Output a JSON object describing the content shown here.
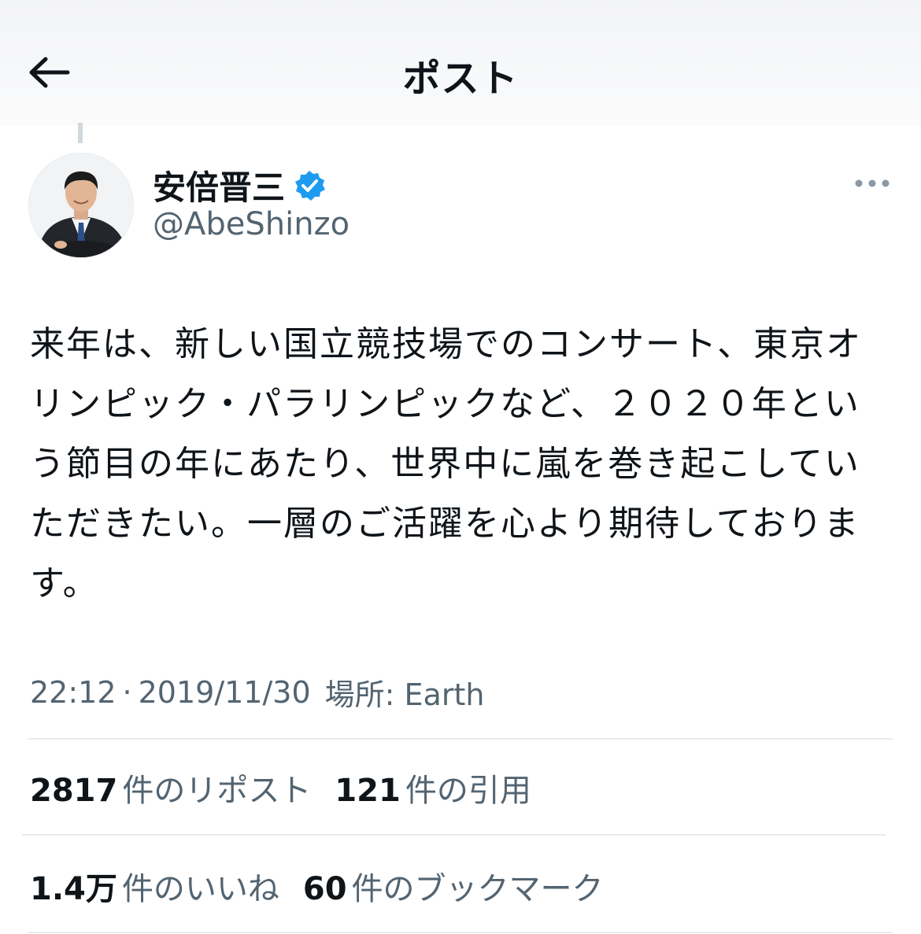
{
  "header": {
    "title": "ポスト",
    "back_icon": "arrow-left-icon"
  },
  "author": {
    "display_name": "安倍晋三",
    "handle": "@AbeShinzo",
    "verified_color": "#1d9bf0"
  },
  "tweet": {
    "text": "来年は、新しい国立競技場でのコンサート、東京オリンピック・パラリンピックなど、２０２０年という節目の年にあたり、世界中に嵐を巻き起こしていただきたい。一層のご活躍を心より期待しております。"
  },
  "meta": {
    "time": "22:12",
    "separator": "·",
    "date": "2019/11/30",
    "location": "場所: Earth"
  },
  "stats": {
    "reposts": {
      "count": "2817",
      "label": "件のリポスト"
    },
    "quotes": {
      "count": "121",
      "label": "件の引用"
    },
    "likes": {
      "count": "1.4万",
      "label": "件のいいね"
    },
    "bookmarks": {
      "count": "60",
      "label": "件のブックマーク"
    }
  }
}
